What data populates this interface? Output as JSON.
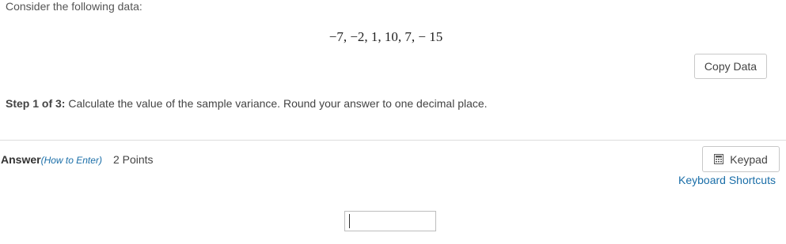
{
  "question": {
    "intro": "Consider the following data:",
    "data_values": "−7, −2, 1, 10, 7, − 15",
    "copy_button_label": "Copy Data"
  },
  "step": {
    "label": "Step 1 of 3:",
    "text": " Calculate the value of the sample variance. Round your answer to one decimal place."
  },
  "answer": {
    "label": "Answer",
    "how_to_enter": "(How to Enter)",
    "points": "2 Points",
    "input_value": ""
  },
  "tools": {
    "keypad_label": "Keypad",
    "keypad_icon": "calculator-icon",
    "shortcuts_label": "Keyboard Shortcuts"
  },
  "colors": {
    "link": "#1a6ea8",
    "text": "#444444",
    "border": "#c8c8c8"
  }
}
